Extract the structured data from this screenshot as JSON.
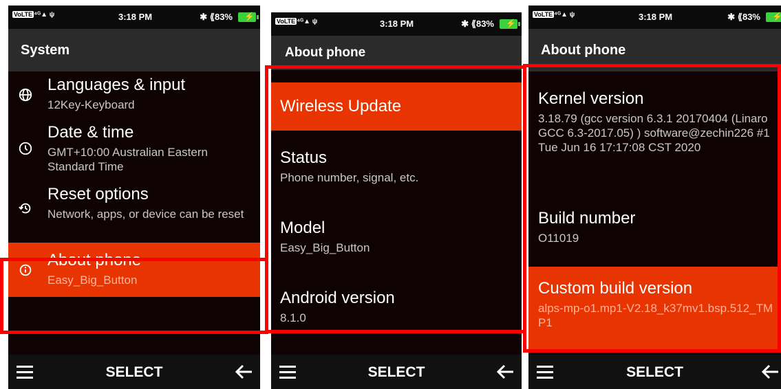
{
  "status": {
    "network": "VoLTE 4G",
    "time": "3:18 PM",
    "battery": "83%"
  },
  "screens": [
    {
      "title": "System",
      "items": [
        {
          "title": "Languages & input",
          "sub": "12Key-Keyboard",
          "icon": "globe-icon"
        },
        {
          "title": "Date & time",
          "sub": "GMT+10:00 Australian Eastern Standard Time",
          "icon": "clock-icon"
        },
        {
          "title": "Reset options",
          "sub": "Network, apps, or device can be reset",
          "icon": "restore-icon"
        },
        {
          "title": "About phone",
          "sub": "Easy_Big_Button",
          "icon": "info-icon"
        }
      ],
      "softkeys": {
        "center": "SELECT"
      }
    },
    {
      "title": "About phone",
      "items": [
        {
          "title": "Wireless Update"
        },
        {
          "title": "Status",
          "sub": "Phone number, signal, etc."
        },
        {
          "title": "Model",
          "sub": "Easy_Big_Button"
        },
        {
          "title": "Android version",
          "sub": "8.1.0"
        }
      ],
      "softkeys": {
        "center": "SELECT"
      }
    },
    {
      "title": "About phone",
      "items": [
        {
          "title": "Kernel version",
          "sub": "3.18.79 (gcc version 6.3.1 20170404 (Linaro GCC 6.3-2017.05) ) software@zechin226 #1 Tue Jun 16 17:17:08 CST 2020"
        },
        {
          "title": "Build number",
          "sub": "O11019"
        },
        {
          "title": "Custom build version",
          "sub": "alps-mp-o1.mp1-V2.18_k37mv1.bsp.512_TMP1"
        }
      ],
      "softkeys": {
        "center": "SELECT"
      }
    }
  ],
  "colors": {
    "highlight": "#e83400",
    "frame": "#ff0000",
    "background": "#0e0202"
  }
}
